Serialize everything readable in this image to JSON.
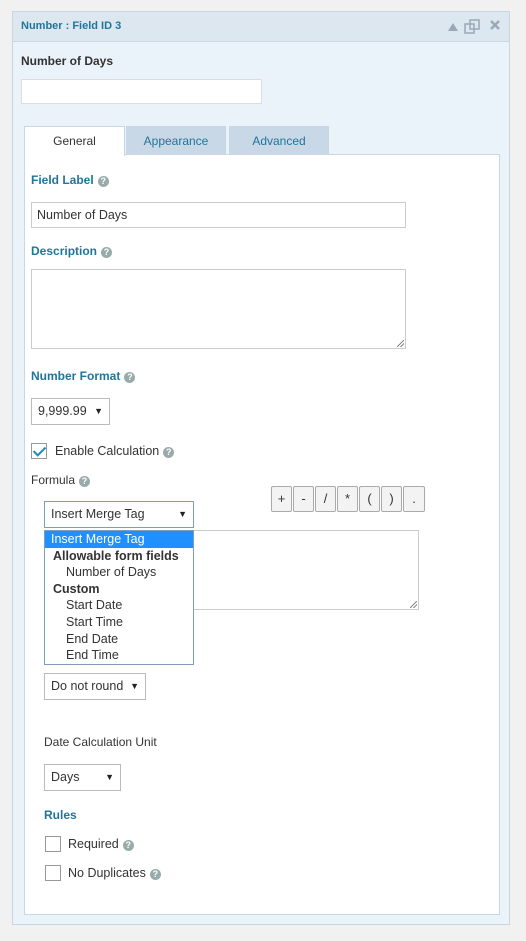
{
  "panel": {
    "title": "Number : Field ID 3",
    "field_name_label": "Number of Days",
    "field_name_value": ""
  },
  "tabs": [
    {
      "label": "General",
      "active": true
    },
    {
      "label": "Appearance",
      "active": false
    },
    {
      "label": "Advanced",
      "active": false
    }
  ],
  "general": {
    "field_label": {
      "label": "Field Label",
      "value": "Number of Days"
    },
    "description": {
      "label": "Description",
      "value": ""
    },
    "number_format": {
      "label": "Number Format",
      "selected": "9,999.99"
    },
    "enable_calculation": {
      "label": "Enable Calculation",
      "checked": true
    },
    "formula": {
      "label": "Formula",
      "merge_tag_select": "Insert Merge Tag",
      "operators": [
        "+",
        "-",
        "/",
        "*",
        "(",
        ")",
        "."
      ]
    },
    "rounding": {
      "selected": "Do not round"
    },
    "date_calc_unit": {
      "label": "Date Calculation Unit",
      "selected": "Days"
    },
    "rules": {
      "label": "Rules",
      "required": {
        "label": "Required",
        "checked": false
      },
      "no_duplicates": {
        "label": "No Duplicates",
        "checked": false
      }
    }
  },
  "merge_tag_dropdown": {
    "selected": "Insert Merge Tag",
    "group1": "Allowable form fields",
    "group1_items": [
      "Number of Days"
    ],
    "group2": "Custom",
    "group2_items": [
      "Start Date",
      "Start Time",
      "End Date",
      "End Time"
    ]
  },
  "colors": {
    "accent": "#21759b",
    "selection": "#1e90ff",
    "panel_bg": "#eaf2fa"
  },
  "icons": {
    "collapse": "triangle-up-icon",
    "duplicate": "duplicate-icon",
    "delete": "close-icon",
    "help": "help-icon"
  }
}
